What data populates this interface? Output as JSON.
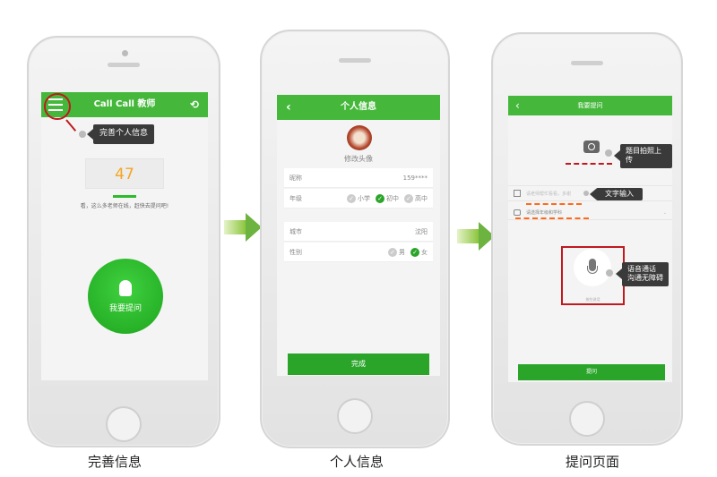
{
  "colors": {
    "accent": "#45b83b",
    "button": "#2aa52a",
    "count": "#f5a623",
    "highlight": "#c0191f",
    "dash_orange": "#ff6a1a"
  },
  "screen1": {
    "title": "Call Call 教师",
    "menu_icon": "hamburger-icon",
    "history_icon": "history-icon",
    "tip": "完善个人信息",
    "online_count": "47",
    "online_text": "看，这么多老师在线，赶快去提问吧!",
    "ask_button": "我要提问",
    "caption": "完善信息"
  },
  "screen2": {
    "title": "个人信息",
    "avatar_label": "修改头像",
    "nickname_label": "昵称",
    "nickname_value": "159****",
    "grade_label": "年级",
    "grade_options": [
      "小学",
      "初中",
      "高中"
    ],
    "grade_selected": "初中",
    "city_label": "城市",
    "city_value": "沈阳",
    "gender_label": "性别",
    "gender_options": [
      "男",
      "女"
    ],
    "gender_selected": "女",
    "done_button": "完成",
    "caption": "个人信息"
  },
  "screen3": {
    "title": "我要提问",
    "photo_tip": "题目拍照上传",
    "text_placeholder": "请老师帮忙看看，多谢",
    "text_tip": "文字输入",
    "subject_placeholder": "请选择年级和学科",
    "voice_label": "按住说话",
    "voice_tip_line1": "语音通话",
    "voice_tip_line2": "沟通无障碍",
    "submit_button": "提问",
    "caption": "提问页面"
  }
}
